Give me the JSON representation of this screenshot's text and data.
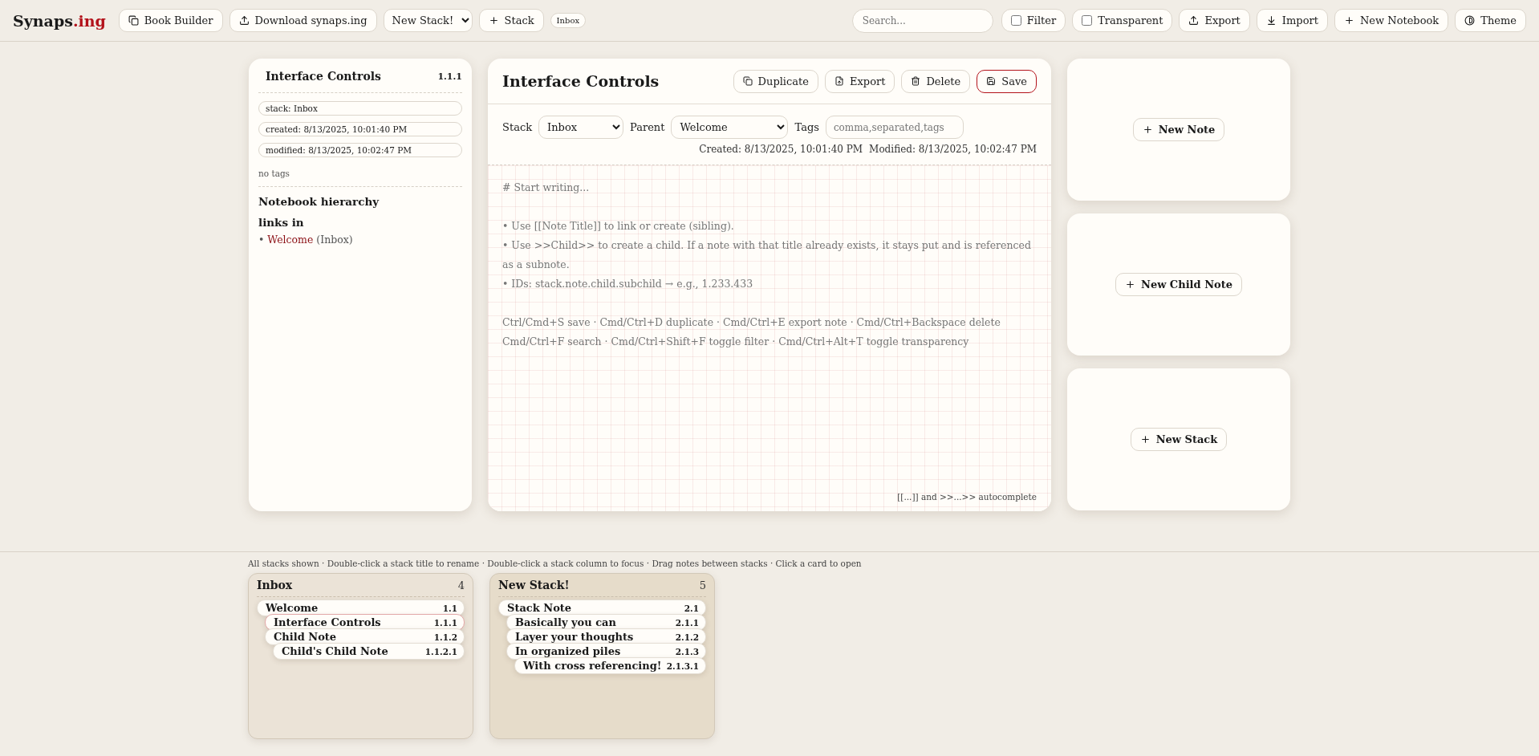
{
  "header": {
    "logo": {
      "main": "Synaps",
      "accent": ".ing"
    },
    "left": [
      {
        "kind": "button",
        "label": "Book Builder"
      },
      {
        "kind": "button",
        "label": "Download synaps.ing"
      },
      {
        "kind": "select",
        "label": "New Stack!"
      },
      {
        "kind": "button",
        "label": "Stack"
      },
      {
        "kind": "chip",
        "label": "Inbox"
      }
    ],
    "search": {
      "placeholder": "Search..."
    },
    "right": [
      {
        "kind": "checkbox",
        "label": "Filter",
        "checked": false
      },
      {
        "kind": "checkbox",
        "label": "Transparent",
        "checked": false
      },
      {
        "kind": "button",
        "label": "Export"
      },
      {
        "kind": "button",
        "label": "Import"
      },
      {
        "kind": "button",
        "label": "New Notebook"
      },
      {
        "kind": "button",
        "label": "Theme"
      }
    ]
  },
  "info_panel": {
    "title": "Interface Controls",
    "id": "1.1.1",
    "chips": [
      "stack: Inbox",
      "created: 8/13/2025, 10:01:40 PM",
      "modified: 8/13/2025, 10:02:47 PM"
    ],
    "tags_note": "no tags",
    "hierarchy_heading": "Notebook hierarchy",
    "links_heading": "links in",
    "links": [
      {
        "bullet": "•",
        "title": "Welcome",
        "stack": "(Inbox)"
      }
    ]
  },
  "editor": {
    "title": "Interface Controls",
    "actions": [
      {
        "label": "Duplicate",
        "primary": false
      },
      {
        "label": "Export",
        "primary": false
      },
      {
        "label": "Delete",
        "primary": false
      },
      {
        "label": "Save",
        "primary": true
      }
    ],
    "stack": {
      "label": "Stack",
      "value": "Inbox"
    },
    "parent": {
      "label": "Parent",
      "value": "Welcome"
    },
    "tags": {
      "label": "Tags",
      "placeholder": "comma,separated,tags"
    },
    "created": "Created: 8/13/2025, 10:01:40 PM",
    "modified": "Modified: 8/13/2025, 10:02:47 PM",
    "placeholder": "# Start writing...\n\n• Use [[Note Title]] to link or create (sibling).\n• Use >>Child>> to create a child. If a note with that title already exists, it stays put and is referenced as a subnote.\n• IDs: stack.note.child.subchild → e.g., 1.233.433\n\nCtrl/Cmd+S save · Cmd/Ctrl+D duplicate · Cmd/Ctrl+E export note · Cmd/Ctrl+Backspace delete\nCmd/Ctrl+F search · Cmd/Ctrl+Shift+F toggle filter · Cmd/Ctrl+Alt+T toggle transparency",
    "hint": "[[...]] and >>...>> autocomplete"
  },
  "quick_actions": [
    "New Note",
    "New Child Note",
    "New Stack"
  ],
  "board": {
    "hint": "All stacks shown · Double-click a stack title to rename · Double-click a stack column to focus · Drag notes between stacks · Click a card to open",
    "stacks": [
      {
        "title": "Inbox",
        "count": "4",
        "notes": [
          {
            "title": "Welcome",
            "id": "1.1",
            "selected": false,
            "children": [
              {
                "title": "Interface Controls",
                "id": "1.1.1",
                "selected": true
              },
              {
                "title": "Child Note",
                "id": "1.1.2",
                "selected": false,
                "children": [
                  {
                    "title": "Child's Child Note",
                    "id": "1.1.2.1",
                    "selected": false
                  }
                ]
              }
            ]
          }
        ]
      },
      {
        "title": "New Stack!",
        "count": "5",
        "notes": [
          {
            "title": "Stack Note",
            "id": "2.1",
            "selected": false,
            "children": [
              {
                "title": "Basically you can",
                "id": "2.1.1",
                "selected": false
              },
              {
                "title": "Layer your thoughts",
                "id": "2.1.2",
                "selected": false
              },
              {
                "title": "In organized piles",
                "id": "2.1.3",
                "selected": false,
                "children": [
                  {
                    "title": "With cross referencing!",
                    "id": "2.1.3.1",
                    "selected": false
                  }
                ]
              }
            ]
          }
        ]
      }
    ]
  }
}
